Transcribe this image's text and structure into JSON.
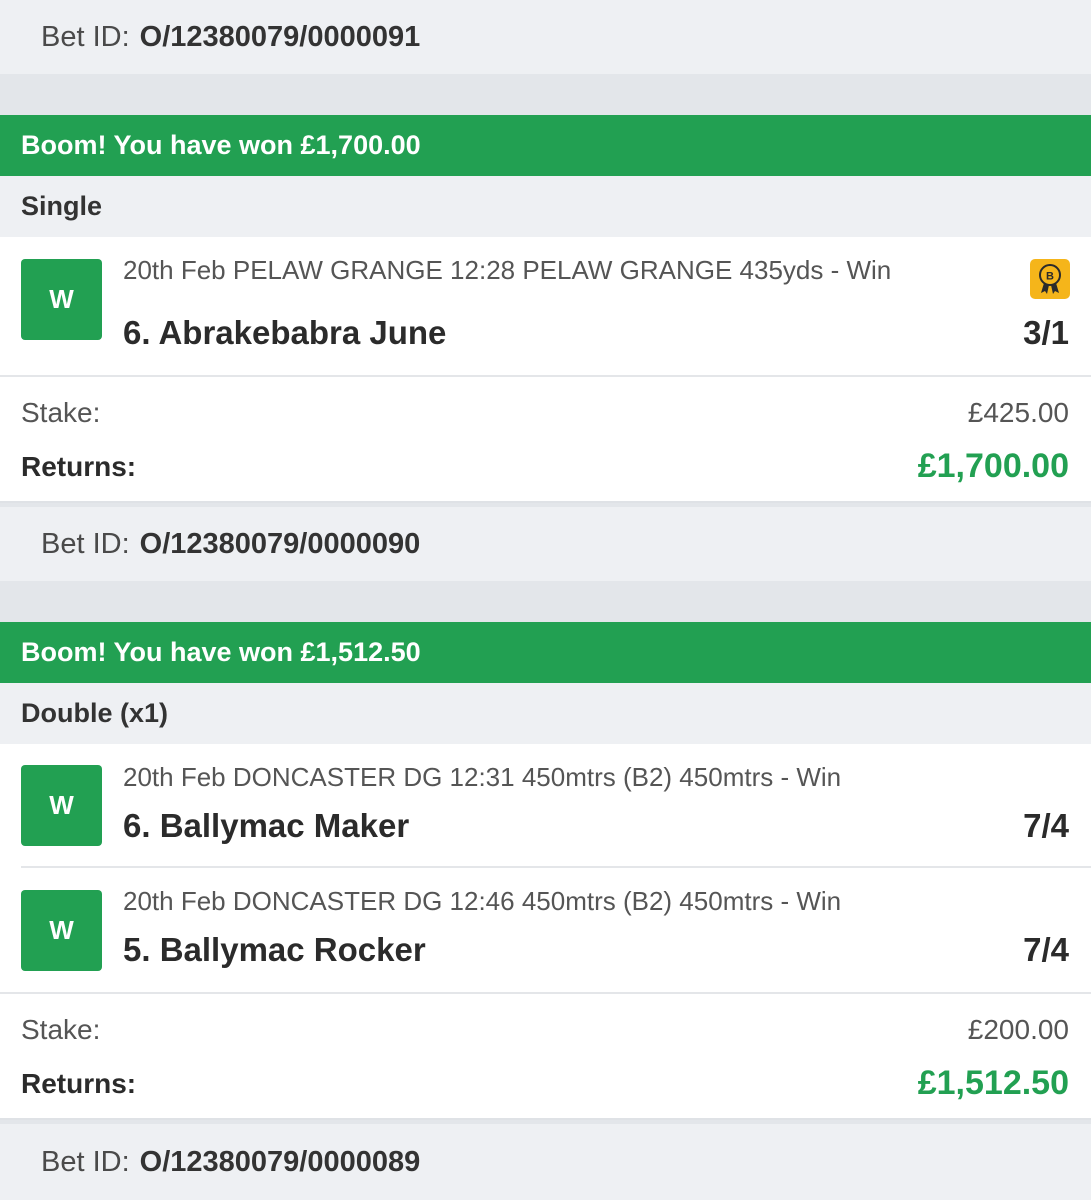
{
  "bet_id_label": "Bet ID:",
  "stake_label": "Stake:",
  "returns_label": "Returns:",
  "bet_ids": [
    "O/12380079/0000091",
    "O/12380079/0000090",
    "O/12380079/0000089"
  ],
  "bets": [
    {
      "banner": "Boom! You have won £1,700.00",
      "type": "Single",
      "selections": [
        {
          "result": "W",
          "event": "20th Feb PELAW GRANGE 12:28 PELAW GRANGE 435yds - Win",
          "runner": "6. Abrakebabra June",
          "odds": "3/1",
          "badge_icon": "boost-ribbon-icon"
        }
      ],
      "stake": "£425.00",
      "returns": "£1,700.00"
    },
    {
      "banner": "Boom! You have won £1,512.50",
      "type": "Double (x1)",
      "selections": [
        {
          "result": "W",
          "event": "20th Feb DONCASTER DG 12:31 450mtrs (B2) 450mtrs - Win",
          "runner": "6. Ballymac Maker",
          "odds": "7/4"
        },
        {
          "result": "W",
          "event": "20th Feb DONCASTER DG 12:46 450mtrs (B2) 450mtrs - Win",
          "runner": "5. Ballymac Rocker",
          "odds": "7/4"
        }
      ],
      "stake": "£200.00",
      "returns": "£1,512.50"
    }
  ],
  "colors": {
    "win_green": "#22a052",
    "badge_gold": "#f5b51a",
    "page_bg": "#e3e6ea",
    "row_bg": "#eef0f3"
  }
}
